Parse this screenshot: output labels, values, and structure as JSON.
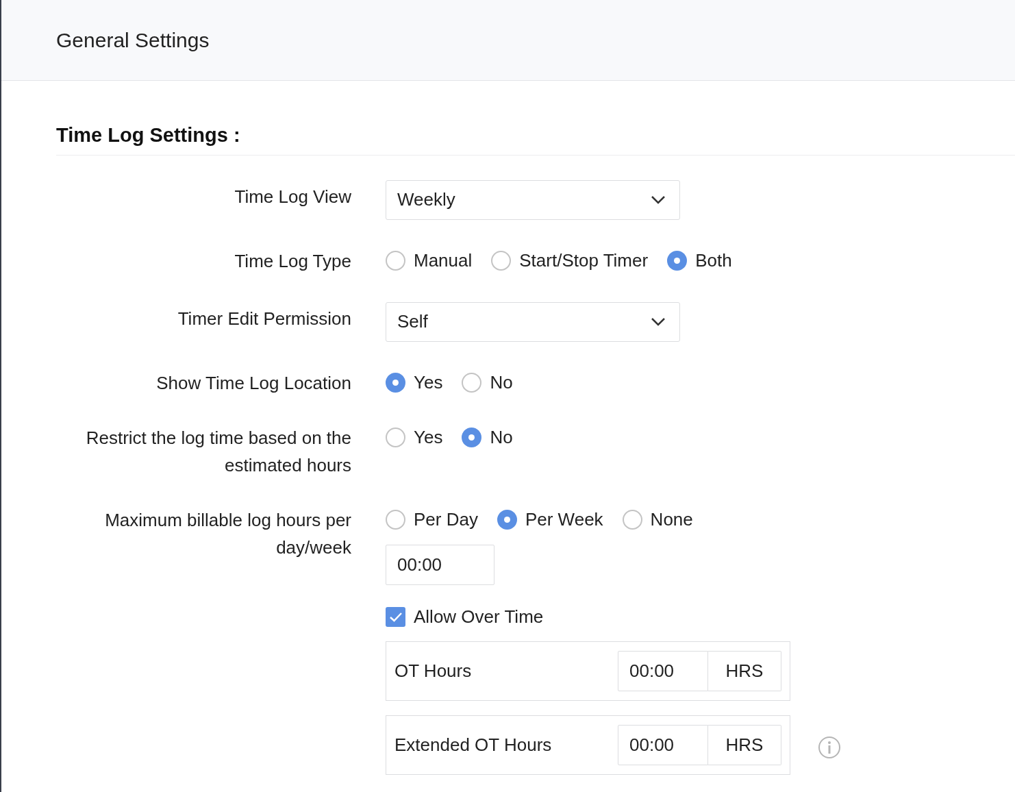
{
  "header": {
    "title": "General Settings"
  },
  "section": {
    "title": "Time Log Settings :"
  },
  "settings": [
    {
      "kind": "select",
      "label": "Time Log View",
      "value": "Weekly"
    },
    {
      "kind": "radio",
      "label": "Time Log Type",
      "options": [
        {
          "label": "Manual",
          "selected": false
        },
        {
          "label": "Start/Stop Timer",
          "selected": false
        },
        {
          "label": "Both",
          "selected": true
        }
      ]
    },
    {
      "kind": "select",
      "label": "Timer Edit Permission",
      "value": "Self"
    },
    {
      "kind": "radio",
      "label": "Show Time Log Location",
      "options": [
        {
          "label": "Yes",
          "selected": true
        },
        {
          "label": "No",
          "selected": false
        }
      ]
    },
    {
      "kind": "radio",
      "label": "Restrict the log time based on the estimated hours",
      "options": [
        {
          "label": "Yes",
          "selected": false
        },
        {
          "label": "No",
          "selected": true
        }
      ]
    },
    {
      "kind": "hours",
      "label": "Maximum billable log hours per day/week",
      "options": [
        {
          "label": "Per Day",
          "selected": false
        },
        {
          "label": "Per Week",
          "selected": true
        },
        {
          "label": "None",
          "selected": false
        }
      ],
      "value": "00:00",
      "overtime": {
        "label": "Allow Over Time",
        "checked": true,
        "rows": [
          {
            "label": "OT Hours",
            "value": "00:00",
            "unit": "HRS",
            "info": false
          },
          {
            "label": "Extended OT Hours",
            "value": "00:00",
            "unit": "HRS",
            "info": true
          }
        ]
      }
    }
  ]
}
